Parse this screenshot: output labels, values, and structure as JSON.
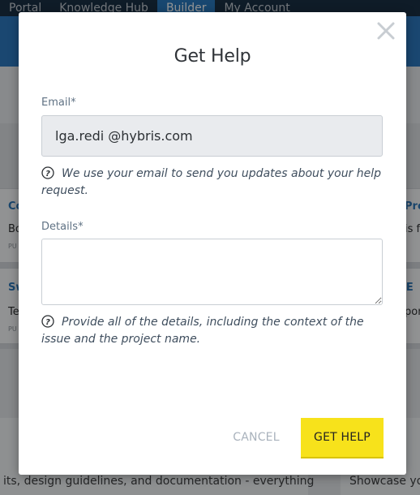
{
  "nav": {
    "tabs": [
      "Portal",
      "Knowledge Hub",
      "Builder",
      "My Account"
    ],
    "active_tab": "Builder"
  },
  "background": {
    "cards": [
      {
        "title": "Co",
        "body": "Bo",
        "meta": "PU"
      },
      {
        "title": "Sw",
        "body": "Te",
        "meta": "PU"
      }
    ],
    "right_cards": [
      {
        "title": "Pro",
        "body": "is f"
      },
      {
        "title": "S E",
        "body": "pon"
      }
    ],
    "footer_left": "its, design guidelines, and documentation - everything",
    "footer_right": "Showcase you"
  },
  "modal": {
    "title": "Get Help",
    "close_icon": "close-icon",
    "email": {
      "label": "Email*",
      "value": "lga.redi @hybris.com",
      "hint": "We use your email to send you updates about your help request."
    },
    "details": {
      "label": "Details*",
      "value": "",
      "hint": "Provide all of the details, including the context of the issue and the project name."
    },
    "hint_icon": "question-circle-icon",
    "cancel_label": "CANCEL",
    "submit_label": "GET HELP"
  },
  "colors": {
    "primary_button": "#f7e21b",
    "nav_bg": "#0b2236",
    "nav_active": "#1d6fb8",
    "label": "#607284",
    "hint": "#3f4e5e"
  }
}
